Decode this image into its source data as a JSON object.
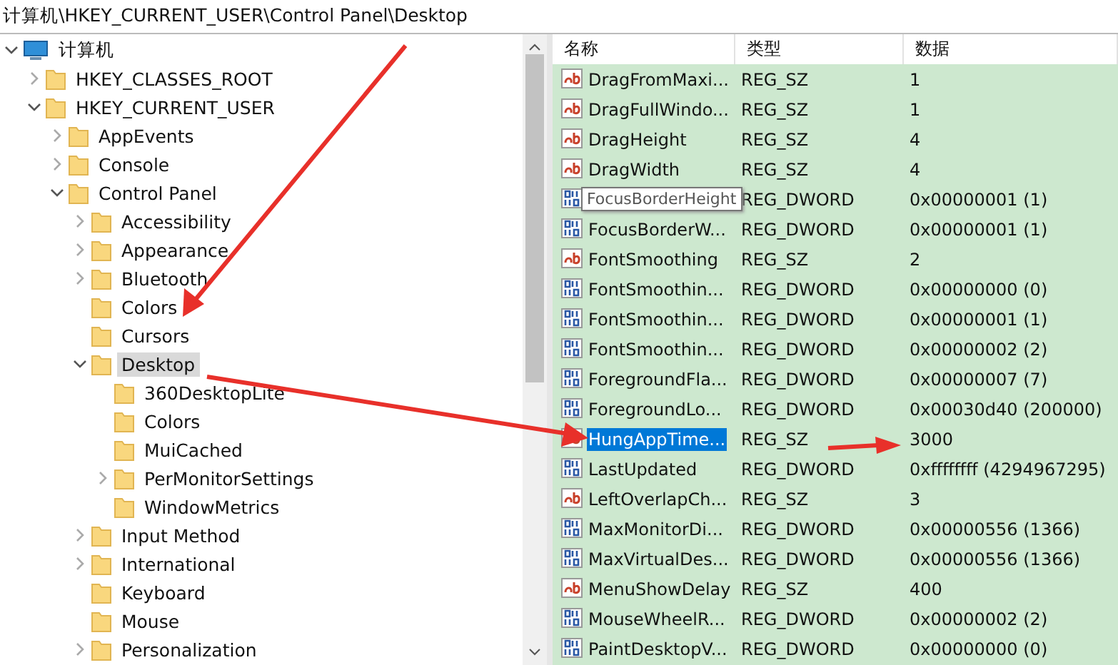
{
  "address_bar": {
    "path": "计算机\\HKEY_CURRENT_USER\\Control Panel\\Desktop"
  },
  "tree": [
    {
      "label": "计算机",
      "kind": "computer",
      "expanded": true,
      "selected": false,
      "children": [
        {
          "label": "HKEY_CLASSES_ROOT",
          "expanded": false,
          "selected": false
        },
        {
          "label": "HKEY_CURRENT_USER",
          "expanded": true,
          "selected": false,
          "children": [
            {
              "label": "AppEvents",
              "expanded": false,
              "selected": false
            },
            {
              "label": "Console",
              "expanded": false,
              "selected": false
            },
            {
              "label": "Control Panel",
              "expanded": true,
              "selected": false,
              "children": [
                {
                  "label": "Accessibility",
                  "expanded": false,
                  "selected": false
                },
                {
                  "label": "Appearance",
                  "expanded": false,
                  "selected": false
                },
                {
                  "label": "Bluetooth",
                  "expanded": false,
                  "selected": false
                },
                {
                  "label": "Colors",
                  "selected": false
                },
                {
                  "label": "Cursors",
                  "selected": false
                },
                {
                  "label": "Desktop",
                  "expanded": true,
                  "selected": true,
                  "children": [
                    {
                      "label": "360DesktopLite",
                      "selected": false
                    },
                    {
                      "label": "Colors",
                      "selected": false
                    },
                    {
                      "label": "MuiCached",
                      "selected": false
                    },
                    {
                      "label": "PerMonitorSettings",
                      "expanded": false,
                      "selected": false
                    },
                    {
                      "label": "WindowMetrics",
                      "selected": false
                    }
                  ]
                },
                {
                  "label": "Input Method",
                  "expanded": false,
                  "selected": false
                },
                {
                  "label": "International",
                  "expanded": false,
                  "selected": false
                },
                {
                  "label": "Keyboard",
                  "selected": false
                },
                {
                  "label": "Mouse",
                  "selected": false
                },
                {
                  "label": "Personalization",
                  "expanded": false,
                  "selected": false
                }
              ]
            }
          ]
        }
      ]
    }
  ],
  "table": {
    "columns": [
      "名称",
      "类型",
      "数据"
    ],
    "rows": [
      {
        "kind": "string",
        "name": "DragFromMaxi...",
        "type": "REG_SZ",
        "data": "1",
        "selected": false
      },
      {
        "kind": "string",
        "name": "DragFullWindo...",
        "type": "REG_SZ",
        "data": "1",
        "selected": false
      },
      {
        "kind": "string",
        "name": "DragHeight",
        "type": "REG_SZ",
        "data": "4",
        "selected": false
      },
      {
        "kind": "string",
        "name": "DragWidth",
        "type": "REG_SZ",
        "data": "4",
        "selected": false
      },
      {
        "kind": "binary",
        "type": "REG_DWORD",
        "data": "0x00000001 (1)",
        "selected": false,
        "tooltip": "FocusBorderHeight"
      },
      {
        "kind": "binary",
        "name": "FocusBorderW...",
        "type": "REG_DWORD",
        "data": "0x00000001 (1)",
        "selected": false
      },
      {
        "kind": "string",
        "name": "FontSmoothing",
        "type": "REG_SZ",
        "data": "2",
        "selected": false
      },
      {
        "kind": "binary",
        "name": "FontSmoothin...",
        "type": "REG_DWORD",
        "data": "0x00000000 (0)",
        "selected": false
      },
      {
        "kind": "binary",
        "name": "FontSmoothin...",
        "type": "REG_DWORD",
        "data": "0x00000001 (1)",
        "selected": false
      },
      {
        "kind": "binary",
        "name": "FontSmoothin...",
        "type": "REG_DWORD",
        "data": "0x00000002 (2)",
        "selected": false
      },
      {
        "kind": "binary",
        "name": "ForegroundFla...",
        "type": "REG_DWORD",
        "data": "0x00000007 (7)",
        "selected": false
      },
      {
        "kind": "binary",
        "name": "ForegroundLo...",
        "type": "REG_DWORD",
        "data": "0x00030d40 (200000)",
        "selected": false
      },
      {
        "kind": "string",
        "name": "HungAppTime...",
        "type": "REG_SZ",
        "data": "3000",
        "selected": true
      },
      {
        "kind": "binary",
        "name": "LastUpdated",
        "type": "REG_DWORD",
        "data": "0xffffffff (4294967295)",
        "selected": false
      },
      {
        "kind": "string",
        "name": "LeftOverlapCh...",
        "type": "REG_SZ",
        "data": "3",
        "selected": false
      },
      {
        "kind": "binary",
        "name": "MaxMonitorDi...",
        "type": "REG_DWORD",
        "data": "0x00000556 (1366)",
        "selected": false
      },
      {
        "kind": "binary",
        "name": "MaxVirtualDes...",
        "type": "REG_DWORD",
        "data": "0x00000556 (1366)",
        "selected": false
      },
      {
        "kind": "string",
        "name": "MenuShowDelay",
        "type": "REG_SZ",
        "data": "400",
        "selected": false
      },
      {
        "kind": "binary",
        "name": "MouseWheelR...",
        "type": "REG_DWORD",
        "data": "0x00000002 (2)",
        "selected": false
      },
      {
        "kind": "binary",
        "name": "PaintDesktopV...",
        "type": "REG_DWORD",
        "data": "0x00000000 (0)",
        "selected": false
      }
    ]
  }
}
